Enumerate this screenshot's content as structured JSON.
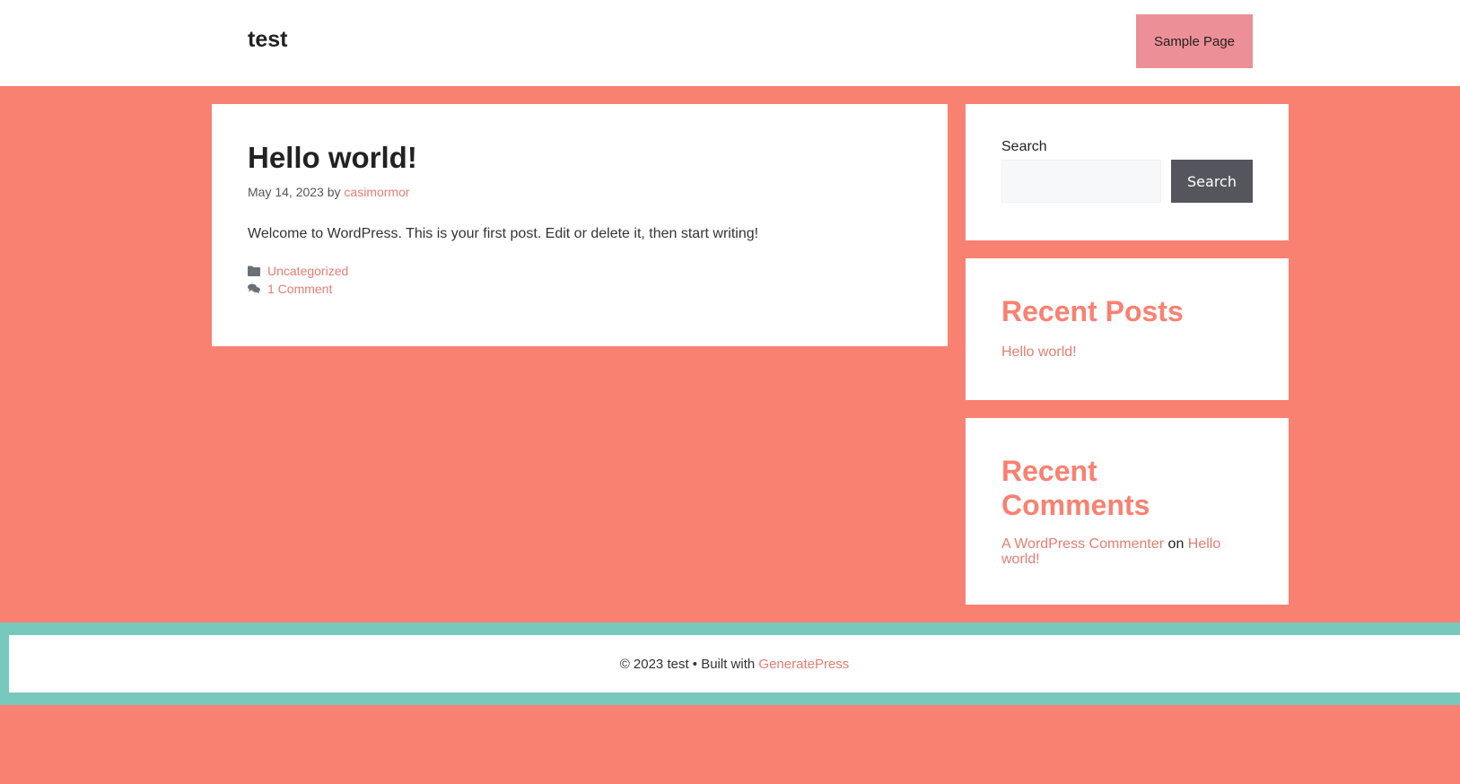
{
  "header": {
    "site_title": "test",
    "nav": {
      "sample_page": "Sample Page"
    }
  },
  "post": {
    "title": "Hello world!",
    "date": "May 14, 2023",
    "by": "by",
    "author": "casimormor",
    "body": "Welcome to WordPress. This is your first post. Edit or delete it, then start writing!",
    "category": "Uncategorized",
    "comments": "1 Comment",
    "icons": {
      "category": "folder-icon",
      "comments": "comments-icon"
    }
  },
  "sidebar": {
    "search": {
      "label": "Search",
      "placeholder": "",
      "button": "Search"
    },
    "recent_posts": {
      "title": "Recent Posts",
      "items": [
        "Hello world!"
      ]
    },
    "recent_comments": {
      "title": "Recent Comments",
      "commenter": "A WordPress Commenter",
      "on": "on",
      "post": "Hello world!"
    }
  },
  "footer": {
    "text": "© 2023 test • Built with",
    "link": "GeneratePress"
  },
  "colors": {
    "background": "#f98171",
    "accent": "#e77d70",
    "nav_button": "#ec8f96",
    "search_button": "#55555e",
    "footer_border": "#77c8bd"
  }
}
